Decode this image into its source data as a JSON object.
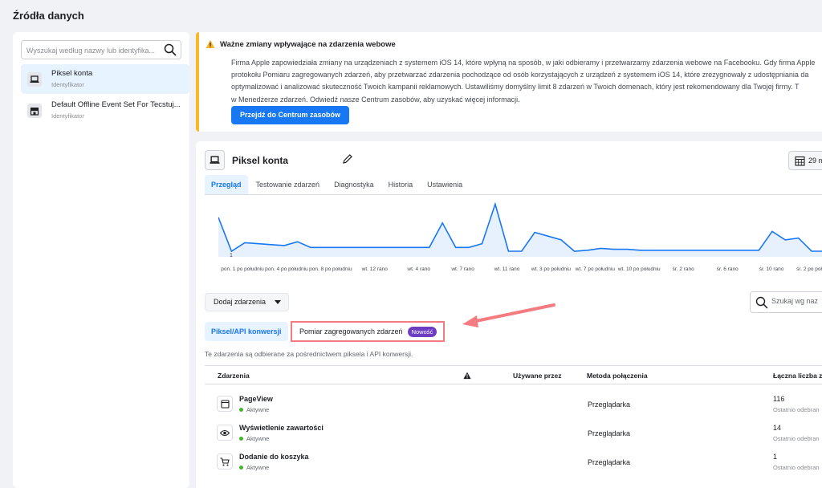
{
  "page": {
    "title": "Źródła danych"
  },
  "sidebar": {
    "search_placeholder": "Wyszukaj według nazwy lub identyfika...",
    "items": [
      {
        "name": "Piksel konta",
        "subtitle": "Identyfikator",
        "icon": "laptop-icon",
        "active": true
      },
      {
        "name": "Default Offline Event Set For Tecstuj...",
        "subtitle": "Identyfikator",
        "icon": "store-icon",
        "active": false
      }
    ]
  },
  "notice": {
    "title": "Ważne zmiany wpływające na zdarzenia webowe",
    "body_lines": [
      "Firma Apple zapowiedziała zmiany na urządzeniach z systemem iOS 14, które wpłyną na sposób, w jaki odbieramy i przetwarzamy zdarzenia webowe na Facebooku. Gdy firma Apple",
      "protokołu Pomiaru zagregowanych zdarzeń, aby przetwarzać zdarzenia pochodzące od osób korzystających z urządzeń z systemem iOS 14, które zrezygnowały z udostępniania da",
      "optymalizować i analizować skuteczność Twoich kampanii reklamowych. Ustawiliśmy domyślny limit 8 zdarzeń w Twoich domenach, który jest rekomendowany dla Twojej firmy. T",
      "w Menedżerze zdarzeń. Odwiedź nasze Centrum zasobów, aby uzyskać więcej informacji."
    ],
    "button": "Przejdź do Centrum zasobów",
    "accent_color": "#f7b928"
  },
  "pixel": {
    "name": "Piksel konta",
    "date_label": "29 m",
    "tabs": [
      "Przegląd",
      "Testowanie zdarzeń",
      "Diagnostyka",
      "Historia",
      "Ustawienia"
    ],
    "active_tab": "Przegląd"
  },
  "chart_data": {
    "type": "area",
    "y_tick": "1",
    "x_ticks": [
      "pon. 1 po południu",
      "pon. 4 po południu",
      "pon. 8 po południu",
      "wt. 12 rano",
      "wt. 4 rano",
      "wt. 7 rano",
      "wt. 11 rano",
      "wt. 3 po południu",
      "wt. 7 po południu",
      "wt. 10 po południu",
      "śr. 2 rano",
      "śr. 6 rano",
      "śr. 10 rano",
      "śr. 2 po południu"
    ],
    "values": [
      4.2,
      0.6,
      1.5,
      1.4,
      1.3,
      1.2,
      1.6,
      1.0,
      1.0,
      1.0,
      1.0,
      1.0,
      1.0,
      1.0,
      1.0,
      1.0,
      1.0,
      3.6,
      1.0,
      1.0,
      1.4,
      5.6,
      0.6,
      0.6,
      2.6,
      2.2,
      1.8,
      0.6,
      0.7,
      0.9,
      0.8,
      0.8,
      0.7,
      0.7,
      0.7,
      0.7,
      0.7,
      0.7,
      0.7,
      0.7,
      0.7,
      0.7,
      2.7,
      1.8,
      2.0,
      0.6,
      0.6,
      4.0
    ],
    "color": "#1877f2"
  },
  "events_section": {
    "add_button": "Dodaj zdarzenia",
    "search_placeholder": "Szukaj wg naz",
    "subtabs": [
      "Piksel/API konwersji",
      "Pomiar zagregowanych zdarzeń"
    ],
    "new_badge": "Nowość",
    "description": "Te zdarzenia są odbierane za pośrednictwem piksela i API konwersji.",
    "columns": [
      "Zdarzenia",
      "Używane przez",
      "Metoda połączenia",
      "Łączna liczba z"
    ],
    "rows": [
      {
        "name": "PageView",
        "status": "Aktywne",
        "method": "Przeglądarka",
        "count": "116",
        "last": "Ostatnio odebran",
        "icon": "browser-window-icon"
      },
      {
        "name": "Wyświetlenie zawartości",
        "status": "Aktywne",
        "method": "Przeglądarka",
        "count": "14",
        "last": "Ostatnio odebran",
        "icon": "eye-icon"
      },
      {
        "name": "Dodanie do koszyka",
        "status": "Aktywne",
        "method": "Przeglądarka",
        "count": "1",
        "last": "Ostatnio odebran",
        "icon": "cart-icon"
      }
    ]
  },
  "annotation": {
    "arrow_color": "#f47b7f"
  }
}
